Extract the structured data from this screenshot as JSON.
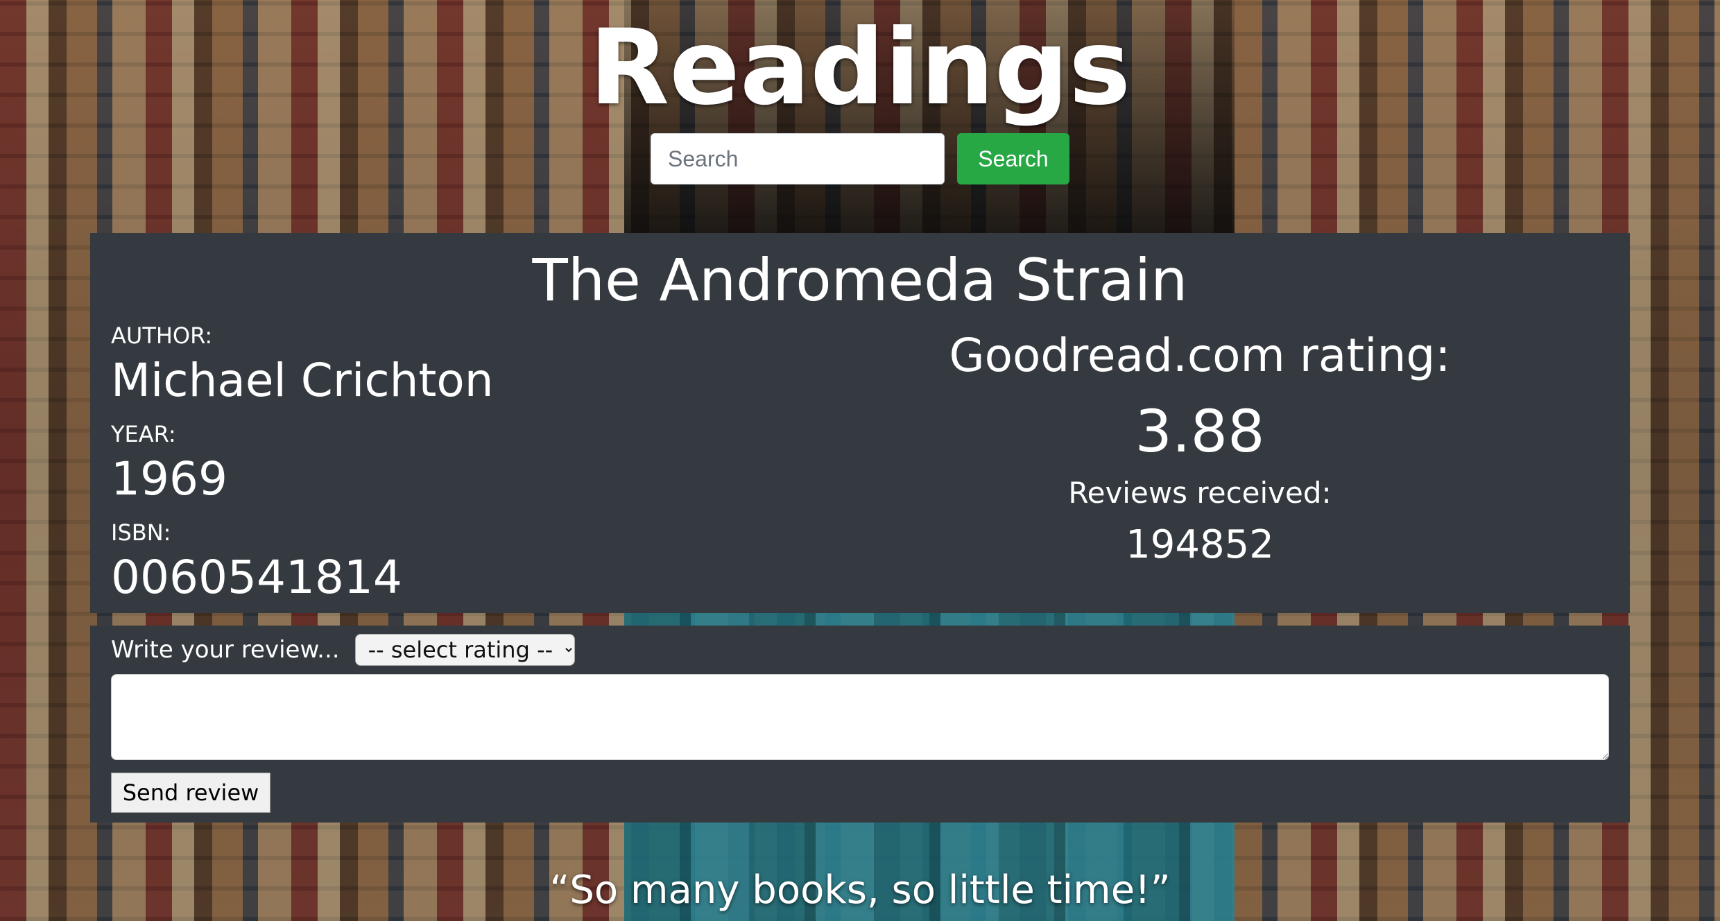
{
  "header": {
    "site_title": "Readings"
  },
  "search": {
    "placeholder": "Search",
    "button_label": "Search"
  },
  "book": {
    "title": "The Andromeda Strain",
    "author_label": "AUTHOR:",
    "author": "Michael Crichton",
    "year_label": "YEAR:",
    "year": "1969",
    "isbn_label": "ISBN:",
    "isbn": "0060541814",
    "rating_heading": "Goodread.com rating:",
    "rating": "3.88",
    "reviews_label": "Reviews received:",
    "reviews_count": "194852"
  },
  "review_form": {
    "prompt": "Write your review...",
    "rating_select_value": "-- select rating --",
    "send_label": "Send review"
  },
  "footer": {
    "quote": "“So many books, so little time!”"
  }
}
